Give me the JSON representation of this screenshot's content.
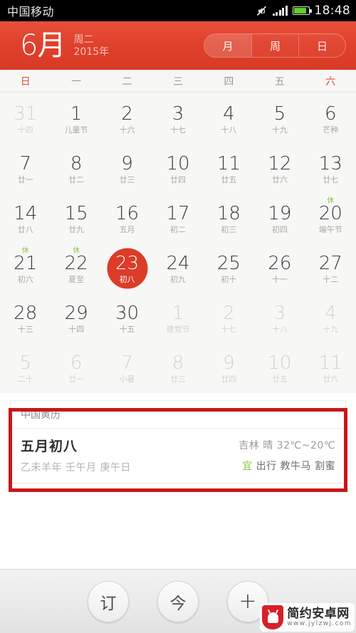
{
  "statusbar": {
    "carrier": "中国移动",
    "clock": "18:48",
    "icons": [
      "mute-icon",
      "signal-icon",
      "battery-icon"
    ]
  },
  "header": {
    "month": "6月",
    "weekday": "周二",
    "year": "2015年",
    "view_tabs": [
      {
        "label": "月",
        "active": true
      },
      {
        "label": "周",
        "active": false
      },
      {
        "label": "日",
        "active": false
      }
    ],
    "accent_color": "#dc3c28"
  },
  "weekdays": [
    {
      "label": "日",
      "weekend": true
    },
    {
      "label": "一",
      "weekend": false
    },
    {
      "label": "二",
      "weekend": false
    },
    {
      "label": "三",
      "weekend": false
    },
    {
      "label": "四",
      "weekend": false
    },
    {
      "label": "五",
      "weekend": false
    },
    {
      "label": "六",
      "weekend": true
    }
  ],
  "calendar": {
    "rows": [
      [
        {
          "day": "31",
          "lunar": "十四",
          "muted": true
        },
        {
          "day": "1",
          "lunar": "儿童节"
        },
        {
          "day": "2",
          "lunar": "十六"
        },
        {
          "day": "3",
          "lunar": "十七"
        },
        {
          "day": "4",
          "lunar": "十八"
        },
        {
          "day": "5",
          "lunar": "十九"
        },
        {
          "day": "6",
          "lunar": "芒种"
        }
      ],
      [
        {
          "day": "7",
          "lunar": "廿一"
        },
        {
          "day": "8",
          "lunar": "廿二"
        },
        {
          "day": "9",
          "lunar": "廿三"
        },
        {
          "day": "10",
          "lunar": "廿四"
        },
        {
          "day": "11",
          "lunar": "廿五"
        },
        {
          "day": "12",
          "lunar": "廿六"
        },
        {
          "day": "13",
          "lunar": "廿七"
        }
      ],
      [
        {
          "day": "14",
          "lunar": "廿八"
        },
        {
          "day": "15",
          "lunar": "廿九"
        },
        {
          "day": "16",
          "lunar": "五月"
        },
        {
          "day": "17",
          "lunar": "初二"
        },
        {
          "day": "18",
          "lunar": "初三"
        },
        {
          "day": "19",
          "lunar": "初四"
        },
        {
          "day": "20",
          "lunar": "端午节",
          "badge": "休"
        }
      ],
      [
        {
          "day": "21",
          "lunar": "初六",
          "badge": "休"
        },
        {
          "day": "22",
          "lunar": "夏至",
          "badge": "休"
        },
        {
          "day": "23",
          "lunar": "初八",
          "selected": true
        },
        {
          "day": "24",
          "lunar": "初九"
        },
        {
          "day": "25",
          "lunar": "初十"
        },
        {
          "day": "26",
          "lunar": "十一"
        },
        {
          "day": "27",
          "lunar": "十二"
        }
      ],
      [
        {
          "day": "28",
          "lunar": "十三"
        },
        {
          "day": "29",
          "lunar": "十四"
        },
        {
          "day": "30",
          "lunar": "十五"
        },
        {
          "day": "1",
          "lunar": "建党节",
          "muted": true
        },
        {
          "day": "2",
          "lunar": "十七",
          "muted": true
        },
        {
          "day": "3",
          "lunar": "十八",
          "muted": true
        },
        {
          "day": "4",
          "lunar": "十九",
          "muted": true
        }
      ],
      [
        {
          "day": "5",
          "lunar": "二十",
          "muted": true
        },
        {
          "day": "6",
          "lunar": "廿一",
          "muted": true
        },
        {
          "day": "7",
          "lunar": "小暑",
          "muted": true
        },
        {
          "day": "8",
          "lunar": "廿三",
          "muted": true
        },
        {
          "day": "9",
          "lunar": "廿四",
          "muted": true
        },
        {
          "day": "10",
          "lunar": "廿五",
          "muted": true
        },
        {
          "day": "11",
          "lunar": "廿六",
          "muted": true
        }
      ]
    ]
  },
  "card": {
    "title": "中国黄历",
    "lunar_date": "五月初八",
    "ganzhi": "乙未羊年 壬午月 庚午日",
    "weather": "吉林 晴 32℃~20℃",
    "yi_mark": "宜",
    "yi_items": "出行 教牛马 割蜜"
  },
  "bottombar": {
    "buttons": [
      {
        "label": "订",
        "name": "subscribe-button"
      },
      {
        "label": "今",
        "name": "today-button"
      },
      {
        "label": "+",
        "name": "add-event-button"
      }
    ]
  },
  "watermark": {
    "name": "简约安卓网",
    "url": "www.jylzwj.com"
  }
}
